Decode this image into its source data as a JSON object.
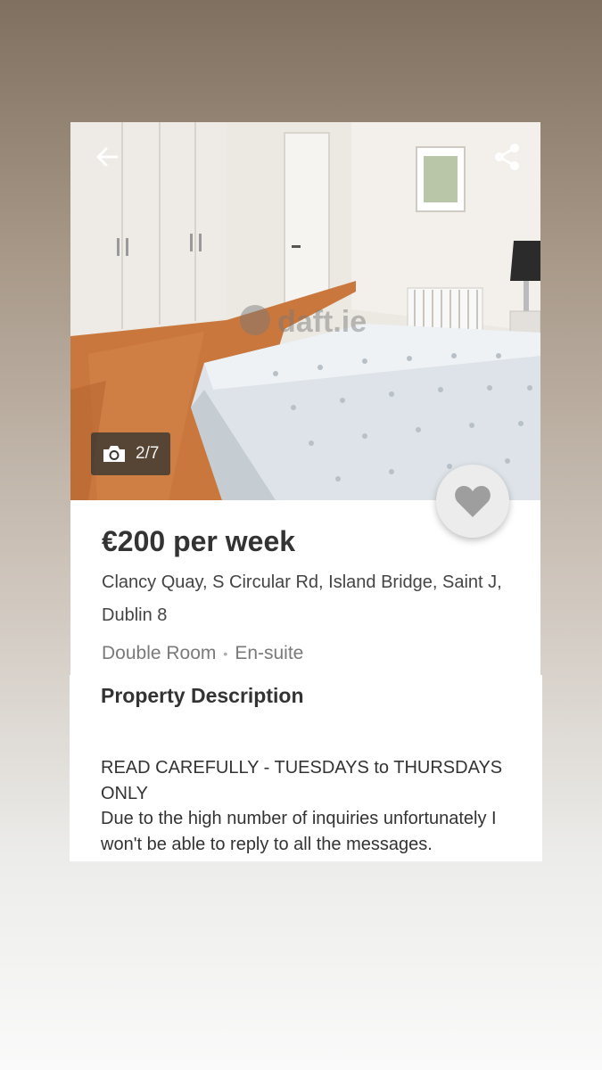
{
  "listing": {
    "photo": {
      "watermark": "daft.ie",
      "counter": "2/7",
      "description": "Bedroom with double bed, white wardrobes, wooden floor"
    },
    "price": "€200 per week",
    "address": "Clancy Quay, S Circular Rd, Island Bridge, Saint J, Dublin 8",
    "features": [
      "Double Room",
      "En-suite"
    ],
    "description": {
      "heading": "Property Description",
      "lines": [
        "READ CAREFULLY - TUESDAYS to THURSDAYS ONLY",
        "Due to the high number of inquiries unfortunately I won't be able to reply to all the messages."
      ]
    }
  },
  "icons": {
    "back": "arrow-left-icon",
    "share": "share-icon",
    "camera": "camera-icon",
    "favorite": "heart-icon"
  },
  "colors": {
    "favorite_heart": "#9e9e9e",
    "counter_background": "#3a3732",
    "price_text": "#333333",
    "feature_text": "#7a7a7a"
  }
}
